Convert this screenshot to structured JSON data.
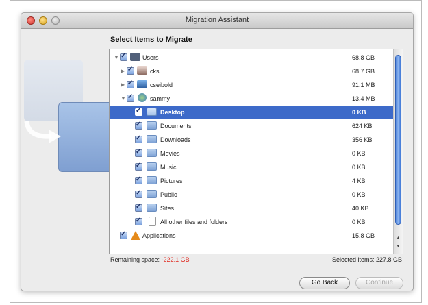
{
  "window": {
    "title": "Migration Assistant"
  },
  "heading": "Select Items to Migrate",
  "items": [
    {
      "name": "Users",
      "size": "68.8 GB"
    },
    {
      "name": "cks",
      "size": "68.7 GB"
    },
    {
      "name": "cseibold",
      "size": "91.1 MB"
    },
    {
      "name": "sammy",
      "size": "13.4 MB"
    },
    {
      "name": "Desktop",
      "size": "0 KB"
    },
    {
      "name": "Documents",
      "size": "624 KB"
    },
    {
      "name": "Downloads",
      "size": "356 KB"
    },
    {
      "name": "Movies",
      "size": "0 KB"
    },
    {
      "name": "Music",
      "size": "0 KB"
    },
    {
      "name": "Pictures",
      "size": "4 KB"
    },
    {
      "name": "Public",
      "size": "0 KB"
    },
    {
      "name": "Sites",
      "size": "40 KB"
    },
    {
      "name": "All other files and folders",
      "size": "0 KB"
    },
    {
      "name": "Applications",
      "size": "15.8 GB"
    }
  ],
  "footer": {
    "remaining_label": "Remaining space:",
    "remaining_value": "-222.1 GB",
    "selected_label": "Selected items: 227.8 GB"
  },
  "buttons": {
    "back": "Go Back",
    "continue": "Continue"
  }
}
